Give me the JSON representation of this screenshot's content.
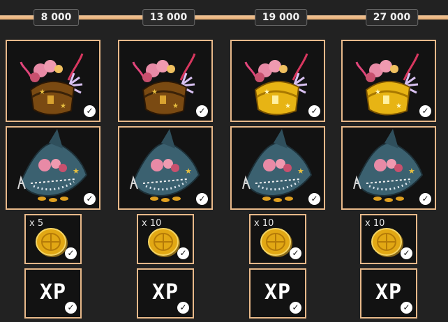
{
  "milestones": [
    {
      "points": "8 000",
      "coin_qty": "x 5",
      "chest": "bronze"
    },
    {
      "points": "13 000",
      "coin_qty": "x 10",
      "chest": "bronze"
    },
    {
      "points": "19 000",
      "coin_qty": "x 10",
      "chest": "gold"
    },
    {
      "points": "27 000",
      "coin_qty": "x 10",
      "chest": "gold"
    }
  ],
  "xp_label": "XP",
  "icons": {
    "claimed": "check-circle-icon",
    "chest": "coral-treasure-chest-icon",
    "shark": "shark-treasure-icon",
    "coin": "gold-coin-icon"
  },
  "colors": {
    "background": "#222222",
    "progress_track": "#f2c79a",
    "card_border": "#e8b98a",
    "card_background": "#121212",
    "bronze_chest": "#7a4a12",
    "gold_chest": "#e7b414",
    "shark": "#3b6170",
    "coin": "#e2a814"
  }
}
